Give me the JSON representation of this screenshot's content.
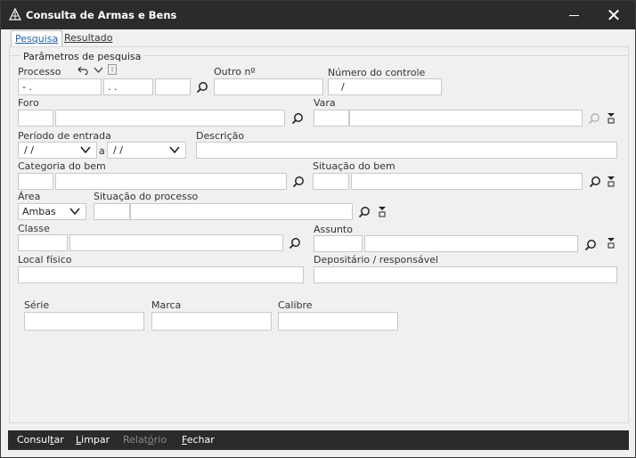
{
  "window": {
    "title": "Consulta de Armas e Bens",
    "close_glyph": "✕",
    "icons": {
      "app": "app-logo-icon",
      "minimize": "minimize-icon",
      "close": "close-icon"
    }
  },
  "tabs": [
    {
      "label": "Pesquisa",
      "active": true
    },
    {
      "label": "Resultado",
      "active": false
    }
  ],
  "group_title": "Parâmetros de pesquisa",
  "fields": {
    "processo": {
      "label": "Processo",
      "part1": "- .",
      "part2": ". .",
      "part3": ""
    },
    "outro": {
      "label": "Outro nº",
      "value": ""
    },
    "controle": {
      "label": "Número do controle",
      "value": "/"
    },
    "foro": {
      "label": "Foro"
    },
    "vara": {
      "label": "Vara"
    },
    "periodo": {
      "label": "Período de entrada",
      "from": "/ /",
      "sep": "a",
      "to": "/ /"
    },
    "descricao": {
      "label": "Descrição"
    },
    "categoria": {
      "label": "Categoria do bem"
    },
    "situacao_bem": {
      "label": "Situação do bem"
    },
    "area": {
      "label": "Área",
      "value": "Ambas"
    },
    "situacao_processo": {
      "label": "Situação do processo"
    },
    "classe": {
      "label": "Classe"
    },
    "assunto": {
      "label": "Assunto"
    },
    "local": {
      "label": "Local físico"
    },
    "depositario": {
      "label": "Depositário / responsável"
    },
    "serie": {
      "label": "Série"
    },
    "marca": {
      "label": "Marca"
    },
    "calibre": {
      "label": "Calibre"
    }
  },
  "buttons": {
    "consultar": {
      "pre": "Consul",
      "u": "t",
      "post": "ar",
      "enabled": true
    },
    "limpar": {
      "pre": "",
      "u": "L",
      "post": "impar",
      "enabled": true
    },
    "relatorio": {
      "pre": "Relat",
      "u": "ó",
      "post": "rio",
      "enabled": false
    },
    "fechar": {
      "pre": "",
      "u": "F",
      "post": "echar",
      "enabled": true
    }
  }
}
